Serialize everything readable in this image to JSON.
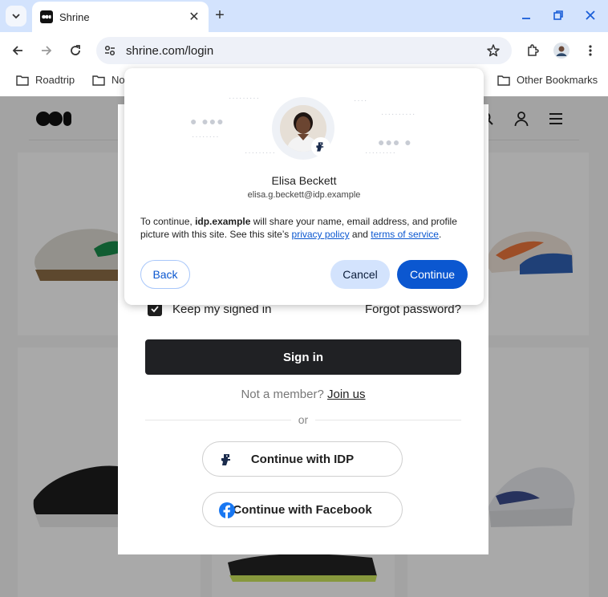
{
  "browser": {
    "tab_title": "Shrine",
    "url": "shrine.com/login",
    "bookmarks": [
      "Roadtrip",
      "No",
      "Other Bookmarks"
    ]
  },
  "login_form": {
    "keep_signed_in": "Keep my signed in",
    "forgot_password": "Forgot password?",
    "sign_in": "Sign in",
    "not_member": "Not a member?",
    "join_us": "Join us",
    "or": "or",
    "continue_idp": "Continue with IDP",
    "continue_facebook": "Continue with Facebook"
  },
  "fedcm_dialog": {
    "name": "Elisa Beckett",
    "email": "elisa.g.beckett@idp.example",
    "desc_prefix": "To continue,",
    "desc_idp": "idp.example",
    "desc_middle": "will share your name, email address, and profile picture with this site. See this site’s",
    "privacy_policy": "privacy policy",
    "desc_and": "and",
    "terms": "terms of service",
    "desc_end": ".",
    "back": "Back",
    "cancel": "Cancel",
    "continue": "Continue"
  },
  "colors": {
    "primary": "#0b57d0",
    "tab_strip": "#d3e3fd",
    "sign_in_button": "#202124"
  }
}
